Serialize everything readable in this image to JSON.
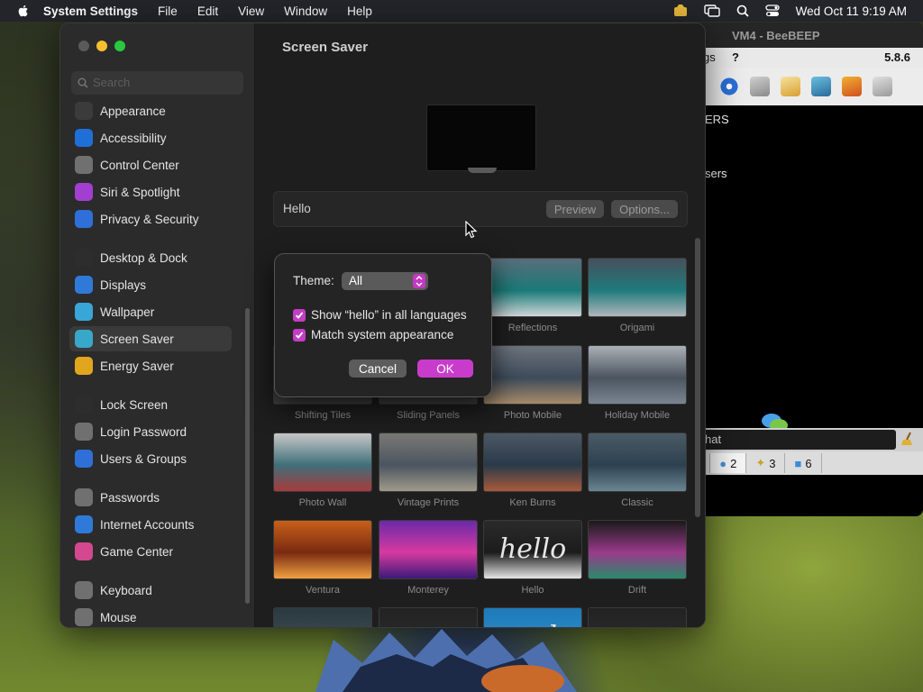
{
  "menubar": {
    "app_name": "System Settings",
    "items": [
      "File",
      "Edit",
      "View",
      "Window",
      "Help"
    ],
    "clock": "Wed Oct 11  9:19 AM"
  },
  "beebeep": {
    "title": "VM4 - BeeBEEP",
    "menu_partial": "gs",
    "menu_help": "?",
    "version": "5.8.6",
    "line1": "ERS",
    "line2": "sers",
    "chat_placeholder": "hat",
    "tabs": [
      "5",
      "2",
      "3",
      "6"
    ]
  },
  "sidebar": {
    "search_placeholder": "Search",
    "groups": [
      [
        {
          "label": "Appearance",
          "icon": "appearance-icon",
          "color": "#3b3b3b"
        },
        {
          "label": "Accessibility",
          "icon": "accessibility-icon",
          "color": "#1f6fd8"
        },
        {
          "label": "Control Center",
          "icon": "control-center-icon",
          "color": "#707070"
        },
        {
          "label": "Siri & Spotlight",
          "icon": "siri-icon",
          "color": "#a23fd0"
        },
        {
          "label": "Privacy & Security",
          "icon": "hand-icon",
          "color": "#2f6fd8"
        }
      ],
      [
        {
          "label": "Desktop & Dock",
          "icon": "dock-icon",
          "color": "#2d2d2d"
        },
        {
          "label": "Displays",
          "icon": "displays-icon",
          "color": "#2f7ad8"
        },
        {
          "label": "Wallpaper",
          "icon": "wallpaper-icon",
          "color": "#38a6d6"
        },
        {
          "label": "Screen Saver",
          "icon": "screen-saver-icon",
          "color": "#37a8c9",
          "selected": true
        },
        {
          "label": "Energy Saver",
          "icon": "energy-saver-icon",
          "color": "#e2a51e"
        }
      ],
      [
        {
          "label": "Lock Screen",
          "icon": "lock-icon",
          "color": "#2d2d2d"
        },
        {
          "label": "Login Password",
          "icon": "password-icon",
          "color": "#707070"
        },
        {
          "label": "Users & Groups",
          "icon": "users-icon",
          "color": "#2f6fd8"
        }
      ],
      [
        {
          "label": "Passwords",
          "icon": "key-icon",
          "color": "#707070"
        },
        {
          "label": "Internet Accounts",
          "icon": "at-icon",
          "color": "#2f7ad8"
        },
        {
          "label": "Game Center",
          "icon": "game-center-icon",
          "color": "#d4488f"
        }
      ],
      [
        {
          "label": "Keyboard",
          "icon": "keyboard-icon",
          "color": "#707070"
        },
        {
          "label": "Mouse",
          "icon": "mouse-icon",
          "color": "#707070"
        }
      ]
    ]
  },
  "main": {
    "title": "Screen Saver",
    "selected_name": "Hello",
    "preview_button": "Preview",
    "options_button": "Options...",
    "tiles": [
      {
        "label": "Reflections",
        "colors": [
          "#5a6d7a",
          "#1a7a78",
          "#cfd6d8"
        ]
      },
      {
        "label": "Origami",
        "colors": [
          "#45505c",
          "#1f7a7c",
          "#b0b6bb"
        ]
      },
      {
        "label": "Shifting Tiles",
        "colors": [
          "#3a3a3a",
          "#2b2b2b",
          "#444"
        ]
      },
      {
        "label": "Sliding Panels",
        "colors": [
          "#3a3a3a",
          "#2b2b2b",
          "#444"
        ]
      },
      {
        "label": "Photo Mobile",
        "colors": [
          "#6d747c",
          "#3d4b5a",
          "#a88b6a"
        ]
      },
      {
        "label": "Holiday Mobile",
        "colors": [
          "#aab0b5",
          "#4b5560",
          "#7a8590"
        ]
      },
      {
        "label": "Photo Wall",
        "colors": [
          "#c8c8c8",
          "#3f6f7a",
          "#a83a3a"
        ]
      },
      {
        "label": "Vintage Prints",
        "colors": [
          "#7a7a74",
          "#4b5560",
          "#a09a8a"
        ]
      },
      {
        "label": "Ken Burns",
        "colors": [
          "#4c5864",
          "#2a3a4a",
          "#a85a3a"
        ]
      },
      {
        "label": "Classic",
        "colors": [
          "#4b5a66",
          "#2d4150",
          "#6b8592"
        ]
      },
      {
        "label": "Ventura",
        "colors": [
          "#c7601a",
          "#7a2a10",
          "#f0a040"
        ]
      },
      {
        "label": "Monterey",
        "colors": [
          "#6a2aa8",
          "#d83aa0",
          "#3a1a78"
        ]
      },
      {
        "label": "Hello",
        "colors": [
          "#2a2a2a",
          "#1c1c1c",
          "#e6e6e6"
        ],
        "text": "hello"
      },
      {
        "label": "Drift",
        "colors": [
          "#1a1a1a",
          "#9a3a8a",
          "#2a8a6a"
        ]
      },
      {
        "label": "",
        "colors": [
          "#2a3a40",
          "#3c4a50",
          "#5a6a70"
        ]
      },
      {
        "label": "",
        "colors": [
          "#222",
          "#2a2a2a",
          "#333"
        ]
      },
      {
        "label": "",
        "colors": [
          "#1e7ab8",
          "#2a8ac8",
          "#3a9ad8"
        ],
        "text": "graphy"
      },
      {
        "label": "",
        "colors": [
          "#222",
          "#2a2a2a",
          "#333"
        ]
      }
    ]
  },
  "dialog": {
    "theme_label": "Theme:",
    "theme_value": "All",
    "option1": "Show “hello” in all languages",
    "option1_checked": true,
    "option2": "Match system appearance",
    "option2_checked": true,
    "cancel": "Cancel",
    "ok": "OK",
    "accent": "#c93ccb"
  }
}
